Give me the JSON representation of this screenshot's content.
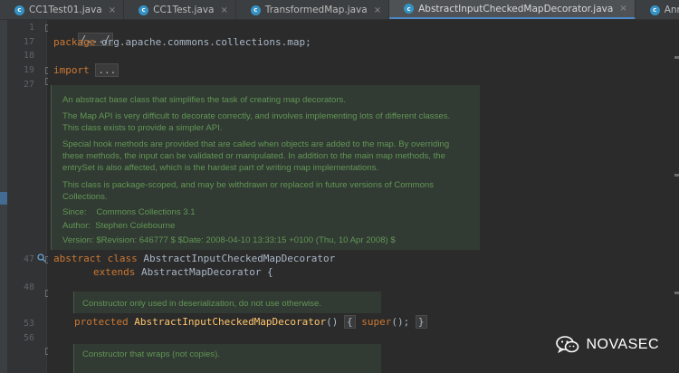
{
  "tabs": [
    {
      "label": "CC1Test01.java",
      "icon": "c",
      "active": false
    },
    {
      "label": "CC1Test.java",
      "icon": "c",
      "active": false
    },
    {
      "label": "TransformedMap.java",
      "icon": "c",
      "active": false
    },
    {
      "label": "AbstractInputCheckedMapDecorator.java",
      "icon": "c",
      "active": true
    },
    {
      "label": "AnnotationInvocationHandler.java",
      "icon": "c",
      "active": false
    }
  ],
  "tab_close_glyph": "×",
  "lines": {
    "l1": "1",
    "l17": "17",
    "l18": "18",
    "l19": "19",
    "l27": "27",
    "l47": "47",
    "l48": "48",
    "l53": "53",
    "l56": "56"
  },
  "code": {
    "line1_fold": "/.../",
    "package_kw": "package",
    "package_name": " org.apache.commons.collections.map;",
    "import_kw": "import",
    "import_fold": "...",
    "abstract_kw": "abstract",
    "class_kw": "class",
    "class_name": "AbstractInputCheckedMapDecorator",
    "extends_kw": "extends",
    "super_class": "AbstractMapDecorator",
    "open_brace": " {",
    "protected_kw": "protected",
    "ctor_name": "AbstractInputCheckedMapDecorator",
    "ctor_parens": "()",
    "ctor_body_open": "{",
    "super_call": "super",
    "super_tail": "();",
    "ctor_body_close": "}"
  },
  "javadoc": {
    "p1": "An abstract base class that simplifies the task of creating map decorators.",
    "p2a": "The Map API is very difficult to decorate correctly, and involves implementing lots of different classes.",
    "p2b": "This class exists to provide a simpler API.",
    "p3a": "Special hook methods are provided that are called when objects are added to the map. By overriding",
    "p3b": "these methods, the input can be validated or manipulated. In addition to the main map methods, the",
    "p3c": "entrySet is also affected, which is the hardest part of writing map implementations.",
    "p4a": "This class is package-scoped, and may be withdrawn or replaced in future versions of Commons",
    "p4b": "Collections.",
    "since": "Since:    Commons Collections 3.1",
    "author": "Author:  Stephen Colebourne",
    "version": "Version: $Revision: 646777 $ $Date: 2008-04-10 13:33:15 +0100 (Thu, 10 Apr 2008) $",
    "ctor1": "Constructor only used in deserialization, do not use otherwise.",
    "ctor2": "Constructor that wraps (not copies)."
  },
  "watermark": {
    "text": "NOVASEC",
    "icon": "wechat-icon"
  },
  "colors": {
    "keyword": "#cc7832",
    "doc": "#629755",
    "code": "#a9b7c6",
    "active_tab_underline": "#4a88c7"
  }
}
